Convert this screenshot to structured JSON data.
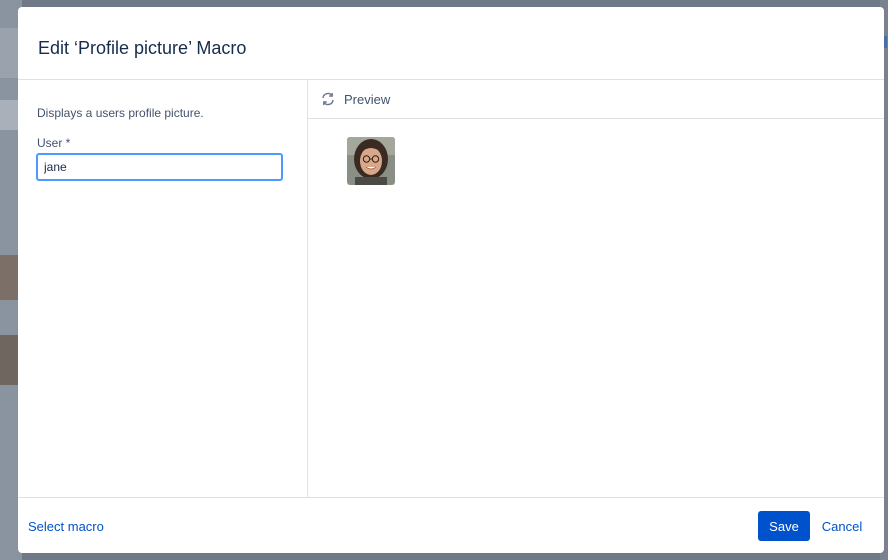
{
  "colors": {
    "accent": "#0052CC",
    "focus_border": "#4C9AFF",
    "overlay": "#707987"
  },
  "dialog": {
    "title": "Edit ‘Profile picture’ Macro"
  },
  "left_panel": {
    "description": "Displays a users profile picture.",
    "user_field": {
      "label": "User *",
      "value": "jane",
      "placeholder": ""
    }
  },
  "preview": {
    "label": "Preview",
    "icon": "refresh-icon",
    "avatar_icon": "avatar"
  },
  "footer": {
    "select_macro": "Select macro",
    "save": "Save",
    "cancel": "Cancel"
  }
}
